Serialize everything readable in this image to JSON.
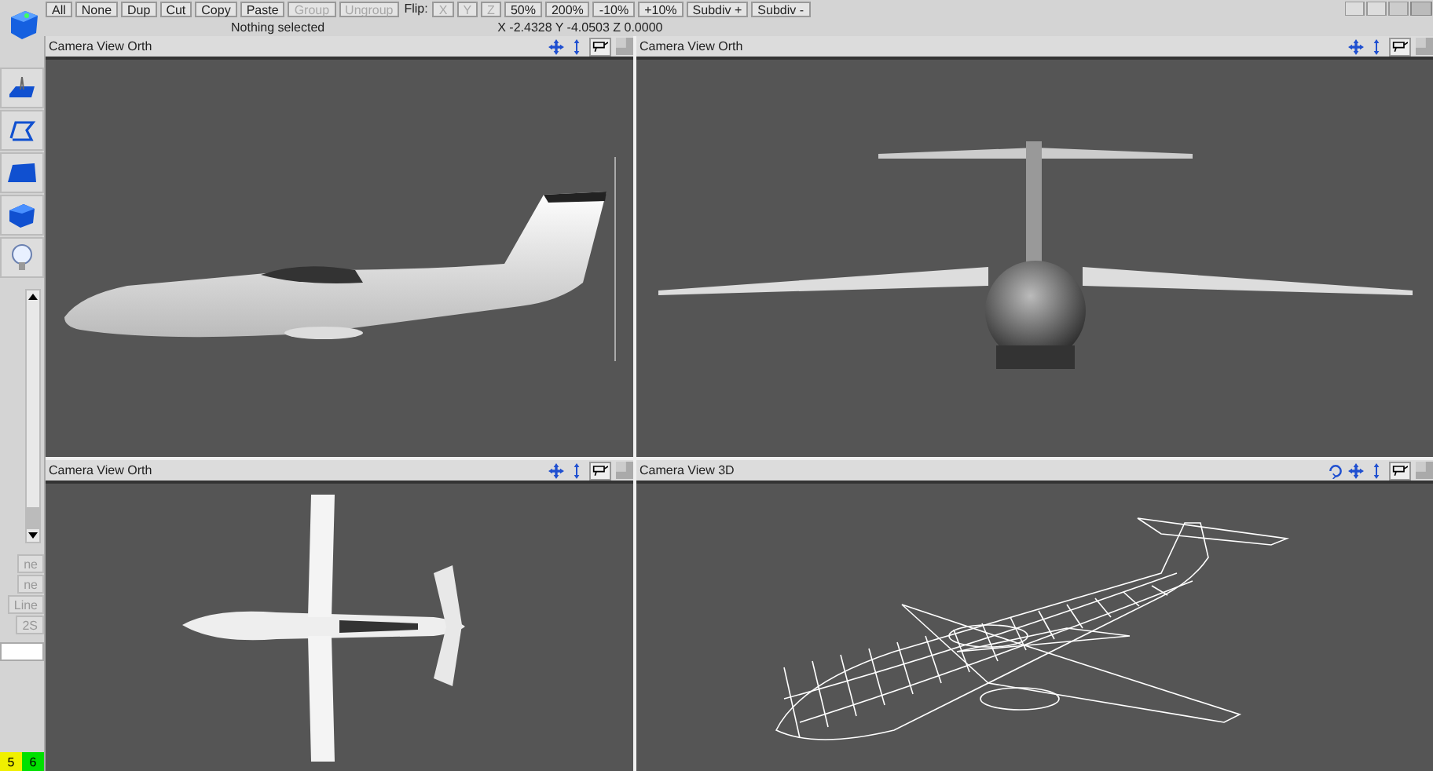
{
  "toolbar": {
    "buttons": [
      {
        "label": "All",
        "disabled": false
      },
      {
        "label": "None",
        "disabled": false
      },
      {
        "label": "Dup",
        "disabled": false
      },
      {
        "label": "Cut",
        "disabled": false
      },
      {
        "label": "Copy",
        "disabled": false
      },
      {
        "label": "Paste",
        "disabled": false
      },
      {
        "label": "Group",
        "disabled": true
      },
      {
        "label": "Ungroup",
        "disabled": true
      },
      {
        "label": "Flip:",
        "kind": "label"
      },
      {
        "label": "X",
        "disabled": true
      },
      {
        "label": "Y",
        "disabled": true
      },
      {
        "label": "Z",
        "disabled": true
      },
      {
        "label": "50%",
        "disabled": false
      },
      {
        "label": "200%",
        "disabled": false
      },
      {
        "label": "-10%",
        "disabled": false
      },
      {
        "label": "+10%",
        "disabled": false
      },
      {
        "label": "Subdiv +",
        "disabled": false
      },
      {
        "label": "Subdiv -",
        "disabled": false
      }
    ]
  },
  "status": {
    "selection": "Nothing selected",
    "coordinates": "X -2.4328 Y -4.0503 Z 0.0000"
  },
  "sidebar": {
    "tools": [
      {
        "kind": "terrain"
      },
      {
        "kind": "spline"
      },
      {
        "kind": "plane"
      },
      {
        "kind": "cube"
      },
      {
        "kind": "light"
      }
    ],
    "partial_buttons": [
      "ne",
      "ne",
      "Line",
      "2S"
    ],
    "layers": [
      {
        "label": "5",
        "color": "#f0f000"
      },
      {
        "label": "6",
        "color": "#00e000"
      }
    ]
  },
  "viewports": [
    {
      "title": "Camera View Orth",
      "kind": "side",
      "rotate_control": false
    },
    {
      "title": "Camera View Orth",
      "kind": "front",
      "rotate_control": false
    },
    {
      "title": "Camera View Orth",
      "kind": "top",
      "rotate_control": false
    },
    {
      "title": "Camera View 3D",
      "kind": "wireframe",
      "rotate_control": true
    }
  ]
}
